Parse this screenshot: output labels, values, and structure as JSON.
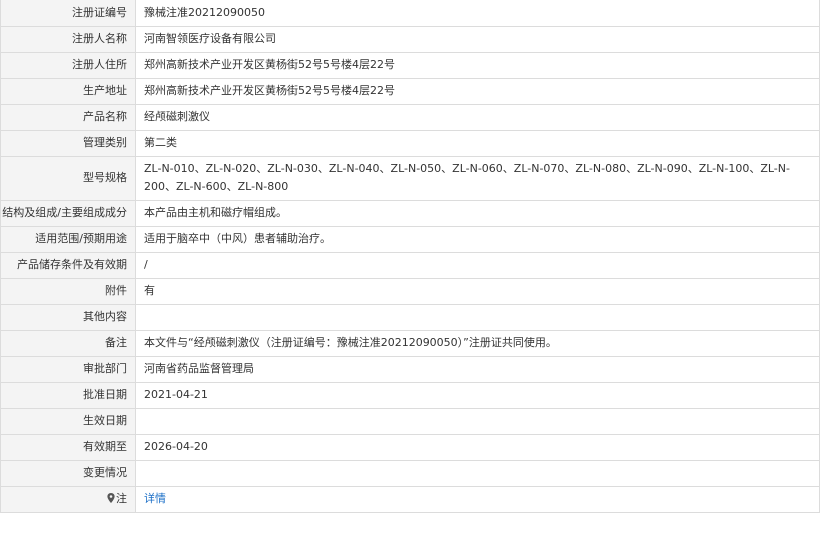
{
  "rows": [
    {
      "label": "注册证编号",
      "value": "豫械注准20212090050"
    },
    {
      "label": "注册人名称",
      "value": "河南智领医疗设备有限公司"
    },
    {
      "label": "注册人住所",
      "value": "郑州高新技术产业开发区黄杨街52号5号楼4层22号"
    },
    {
      "label": "生产地址",
      "value": "郑州高新技术产业开发区黄杨街52号5号楼4层22号"
    },
    {
      "label": "产品名称",
      "value": "经颅磁刺激仪"
    },
    {
      "label": "管理类别",
      "value": "第二类"
    },
    {
      "label": "型号规格",
      "value": "ZL-N-010、ZL-N-020、ZL-N-030、ZL-N-040、ZL-N-050、ZL-N-060、ZL-N-070、ZL-N-080、ZL-N-090、ZL-N-100、ZL-N-200、ZL-N-600、ZL-N-800"
    },
    {
      "label": "结构及组成/主要组成成分",
      "value": "本产品由主机和磁疗帽组成。"
    },
    {
      "label": "适用范围/预期用途",
      "value": "适用于脑卒中（中风）患者辅助治疗。"
    },
    {
      "label": "产品储存条件及有效期",
      "value": "/"
    },
    {
      "label": "附件",
      "value": "有"
    },
    {
      "label": "其他内容",
      "value": ""
    },
    {
      "label": "备注",
      "value": "本文件与“经颅磁刺激仪（注册证编号：豫械注准20212090050）”注册证共同使用。"
    },
    {
      "label": "审批部门",
      "value": "河南省药品监督管理局"
    },
    {
      "label": "批准日期",
      "value": "2021-04-21"
    },
    {
      "label": "生效日期",
      "value": ""
    },
    {
      "label": "有效期至",
      "value": "2026-04-20"
    },
    {
      "label": "变更情况",
      "value": ""
    }
  ],
  "note": {
    "label": "注",
    "icon": "map-pin-icon",
    "link": "详情"
  },
  "colors": {
    "label_bg": "#f4f4f4",
    "border": "#dcdcdc",
    "link": "#1a6ec7"
  }
}
